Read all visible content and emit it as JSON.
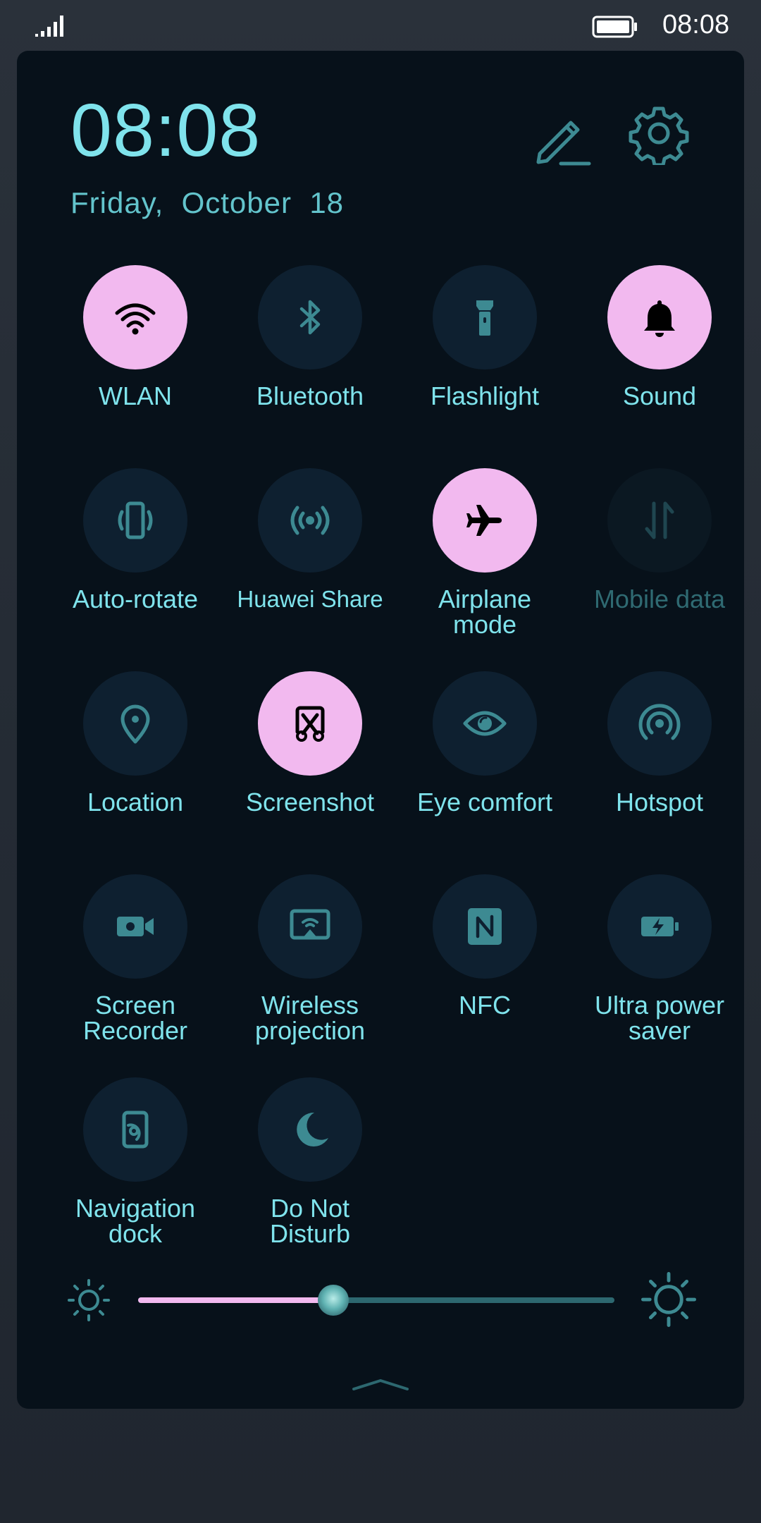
{
  "status_bar": {
    "time": "08:08",
    "battery_level": 1.0
  },
  "header": {
    "clock": "08:08",
    "date": "Friday,  October  18"
  },
  "colors": {
    "accent_on": "#f2b9ef",
    "tile_off": "#0e2030",
    "text": "#7fe3ec",
    "panel_bg": "#07111a"
  },
  "tiles": [
    {
      "label": "WLAN",
      "icon": "wifi-icon",
      "state": "on"
    },
    {
      "label": "Bluetooth",
      "icon": "bluetooth-icon",
      "state": "off"
    },
    {
      "label": "Flashlight",
      "icon": "flashlight-icon",
      "state": "off"
    },
    {
      "label": "Sound",
      "icon": "bell-icon",
      "state": "on"
    },
    {
      "label": "Auto-rotate",
      "icon": "vibrate-phone-icon",
      "state": "off"
    },
    {
      "label": "Huawei Share",
      "icon": "share-waves-icon",
      "state": "off"
    },
    {
      "label": "Airplane\nmode",
      "icon": "airplane-icon",
      "state": "on"
    },
    {
      "label": "Mobile data",
      "icon": "data-arrows-icon",
      "state": "disabled"
    },
    {
      "label": "Location",
      "icon": "location-pin-icon",
      "state": "off"
    },
    {
      "label": "Screenshot",
      "icon": "scissors-icon",
      "state": "on"
    },
    {
      "label": "Eye comfort",
      "icon": "eye-icon",
      "state": "off"
    },
    {
      "label": "Hotspot",
      "icon": "hotspot-icon",
      "state": "off"
    },
    {
      "label": "Screen\nRecorder",
      "icon": "video-camera-icon",
      "state": "off"
    },
    {
      "label": "Wireless\nprojection",
      "icon": "cast-icon",
      "state": "off"
    },
    {
      "label": "NFC",
      "icon": "nfc-icon",
      "state": "off"
    },
    {
      "label": "Ultra power\nsaver",
      "icon": "battery-bolt-icon",
      "state": "off"
    },
    {
      "label": "Navigation\ndock",
      "icon": "nav-dock-icon",
      "state": "off"
    },
    {
      "label": "Do Not\nDisturb",
      "icon": "moon-icon",
      "state": "off"
    }
  ],
  "brightness": {
    "level": 0.41
  }
}
